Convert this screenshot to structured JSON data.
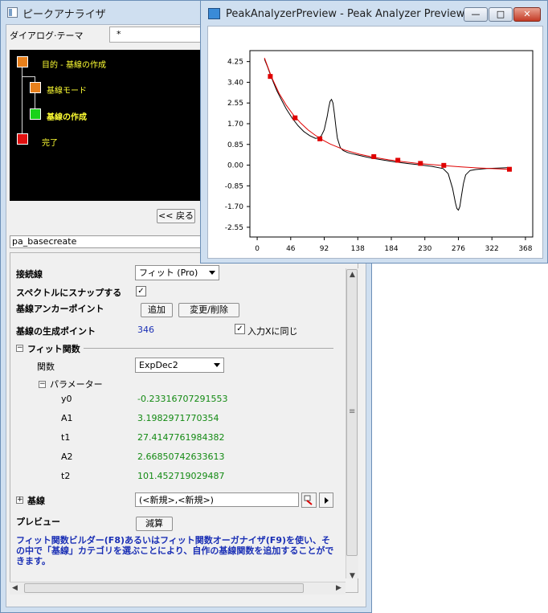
{
  "main_window": {
    "title": "ピークアナライザ",
    "theme_label": "ダイアログ·テーマ",
    "theme_value": "*",
    "flow": [
      {
        "label": "目的 - 基線の作成",
        "color": "#e8801c"
      },
      {
        "label": "基線モード",
        "color": "#e8801c"
      },
      {
        "label": "基線の作成",
        "color": "#19d219"
      },
      {
        "label": "完了",
        "color": "#e01010"
      }
    ],
    "back_button": "<< 戻る",
    "section_name": "pa_basecreate",
    "settings": {
      "connect_label": "接続線",
      "connect_value": "フィット (Pro)",
      "snap_label": "スペクトルにスナップする",
      "snap_checked": "✓",
      "anchor_label": "基線アンカーポイント",
      "add_button": "追加",
      "modify_button": "変更/削除",
      "points_label": "基線の生成ポイント",
      "points_value": "346",
      "same_as_input_label": "入力Xに同じ",
      "same_as_input_checked": "✓",
      "fit_func_section": "フィット関数",
      "func_label": "関数",
      "func_value": "ExpDec2",
      "params_section": "パラメーター",
      "params": [
        {
          "name": "y0",
          "value": "-0.23316707291553"
        },
        {
          "name": "A1",
          "value": "3.1982971770354"
        },
        {
          "name": "t1",
          "value": "27.4147761984382"
        },
        {
          "name": "A2",
          "value": "2.66850742633613"
        },
        {
          "name": "t2",
          "value": "101.452719029487"
        }
      ],
      "baseline_label": "基線",
      "baseline_value": "(<新規>,<新規>)",
      "preview_label": "プレビュー",
      "subtract_button": "減算",
      "help_text": "フィット関数ビルダー(F8)あるいはフィット関数オーガナイザ(F9)を使い、その中で「基線」カテゴリを選ぶことにより、自作の基線関数を追加することができます。"
    }
  },
  "preview_window": {
    "title": "PeakAnalyzerPreview - Peak Analyzer Preview *",
    "buttons": {
      "minimize": "—",
      "maximize": "□",
      "close": "✕"
    }
  },
  "chart_data": {
    "type": "line",
    "x_ticks": [
      "0",
      "46",
      "92",
      "138",
      "184",
      "230",
      "276",
      "322",
      "368"
    ],
    "y_ticks": [
      "4.25",
      "3.40",
      "2.55",
      "1.70",
      "0.85",
      "0.00",
      "-0.85",
      "-1.70",
      "-2.55"
    ],
    "xlim": [
      -10,
      378
    ],
    "ylim": [
      -2.95,
      4.7
    ],
    "series": [
      {
        "role": "signal",
        "color": "#000000",
        "x": [
          10,
          14,
          18,
          22,
          27,
          33,
          40,
          48,
          56,
          64,
          72,
          80,
          84,
          88,
          92,
          96,
          98,
          100,
          102,
          104,
          106,
          108,
          110,
          114,
          118,
          124,
          130,
          140,
          150,
          160,
          175,
          190,
          205,
          220,
          240,
          255,
          262,
          268,
          272,
          274,
          276,
          278,
          280,
          283,
          286,
          292,
          300,
          315,
          330,
          345
        ],
        "y": [
          4.35,
          4.05,
          3.72,
          3.42,
          3.05,
          2.7,
          2.3,
          1.93,
          1.62,
          1.38,
          1.21,
          1.1,
          1.12,
          1.2,
          1.45,
          2.0,
          2.35,
          2.62,
          2.7,
          2.55,
          2.1,
          1.55,
          1.1,
          0.72,
          0.6,
          0.52,
          0.47,
          0.4,
          0.33,
          0.27,
          0.2,
          0.13,
          0.07,
          0.02,
          -0.05,
          -0.14,
          -0.35,
          -0.95,
          -1.55,
          -1.78,
          -1.85,
          -1.7,
          -1.3,
          -0.75,
          -0.4,
          -0.22,
          -0.18,
          -0.14,
          -0.12,
          -0.1
        ]
      },
      {
        "role": "baseline-fit",
        "color": "#e00000",
        "x": [
          10,
          20,
          30,
          40,
          50,
          60,
          70,
          80,
          90,
          100,
          120,
          140,
          160,
          180,
          200,
          220,
          240,
          260,
          280,
          300,
          320,
          345
        ],
        "y": [
          4.4,
          3.6,
          2.95,
          2.45,
          2.05,
          1.72,
          1.44,
          1.22,
          1.03,
          0.87,
          0.62,
          0.45,
          0.32,
          0.22,
          0.14,
          0.07,
          0.02,
          -0.03,
          -0.07,
          -0.11,
          -0.14,
          -0.17
        ]
      }
    ],
    "anchors": {
      "color": "#e00000",
      "x": [
        18,
        52,
        86,
        160,
        193,
        224,
        256,
        346
      ],
      "y": [
        3.64,
        1.94,
        1.08,
        0.35,
        0.2,
        0.07,
        -0.01,
        -0.17
      ]
    }
  }
}
